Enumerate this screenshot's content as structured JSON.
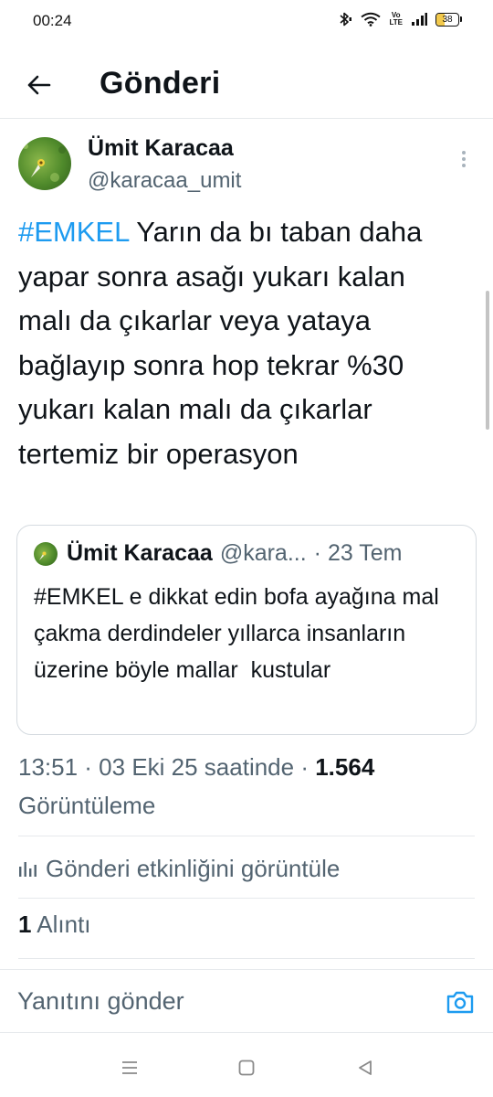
{
  "status_bar": {
    "time": "00:24",
    "volte_label": "Vo\nLTE",
    "battery_level": "38",
    "icons": [
      "bluetooth-icon",
      "wifi-icon",
      "volte-icon",
      "signal-icon",
      "battery-icon"
    ]
  },
  "header": {
    "title": "Gönderi",
    "back_icon": "arrow-left-icon"
  },
  "post": {
    "author_name": "Ümit Karacaa",
    "author_handle": "@karacaa_umit",
    "hashtag": "#EMKEL",
    "text": " Yarın da bı taban daha yapar sonra asağı yukarı kalan malı da çıkarlar veya yataya bağlayıp sonra hop tekrar %30 yukarı kalan malı da çıkarlar tertemiz bir operasyon",
    "quoted": {
      "author_name": "Ümit Karacaa",
      "author_handle": "@kara...",
      "date": "· 23 Tem",
      "text": "#EMKEL e dikkat edin bofa ayağına mal çakma derdindeler yıllarca insanların üzerine böyle mallar  kustular"
    },
    "timestamp": "13:51 · 03 Eki 25 saatinde ·",
    "views_count": "1.564",
    "views_label": "Görüntüleme",
    "activity_label": "Gönderi etkinliğini görüntüle",
    "quote_count": "1",
    "quote_label": "Alıntı"
  },
  "reply": {
    "placeholder": "Yanıtını gönder",
    "camera_icon": "camera-icon"
  },
  "nav_bar": {
    "icons": [
      "menu-icon",
      "home-square-icon",
      "back-triangle-icon"
    ]
  },
  "colors": {
    "accent": "#1d9bf0",
    "text_primary": "#0f1419",
    "text_secondary": "#536471",
    "divider": "#e6e9ec",
    "battery_fill": "#f2c94c"
  }
}
